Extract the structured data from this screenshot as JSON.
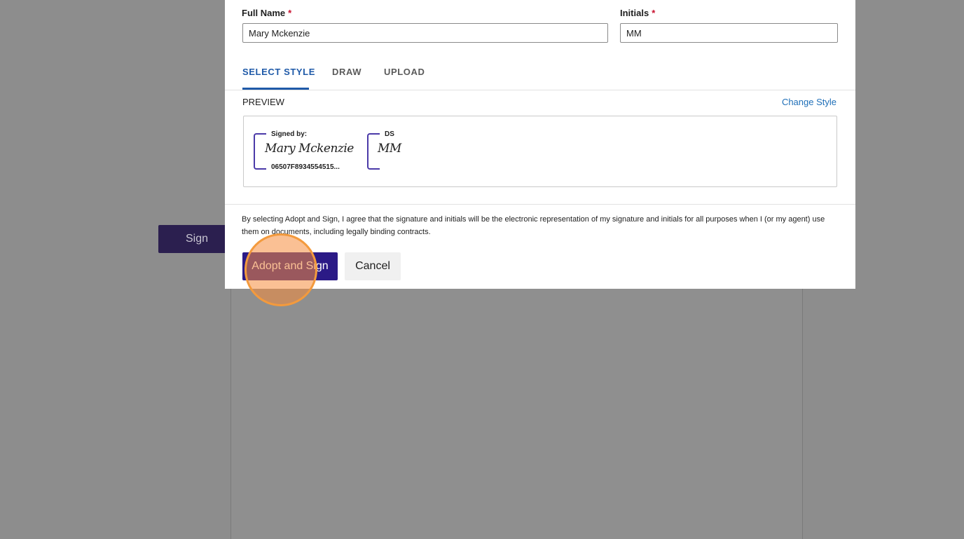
{
  "background": {
    "sign_button_label": "Sign"
  },
  "modal": {
    "full_name": {
      "label": "Full Name",
      "required_mark": "*",
      "value": "Mary Mckenzie"
    },
    "initials": {
      "label": "Initials",
      "required_mark": "*",
      "value": "MM"
    },
    "tabs": [
      {
        "label": "SELECT STYLE",
        "active": true
      },
      {
        "label": "DRAW",
        "active": false
      },
      {
        "label": "UPLOAD",
        "active": false
      }
    ],
    "preview_label": "PREVIEW",
    "change_style_label": "Change Style",
    "signature_preview": {
      "title": "Signed by:",
      "script": "Mary Mckenzie",
      "id": "06507F8934554515..."
    },
    "initials_preview": {
      "title": "DS",
      "script": "MM"
    },
    "legal_text": "By selecting Adopt and Sign, I agree that the signature and initials will be the electronic representation of my signature and initials for all purposes when I (or my agent) use them on documents, including legally binding contracts.",
    "adopt_button_label": "Adopt and Sign",
    "cancel_button_label": "Cancel"
  },
  "colors": {
    "primary_button": "#2b1a86",
    "active_tab": "#1f5aa8",
    "link": "#1f6fb8",
    "required": "#c8102e",
    "signature_bracket": "#4b3aa8",
    "click_highlight": "#f39a3d"
  }
}
